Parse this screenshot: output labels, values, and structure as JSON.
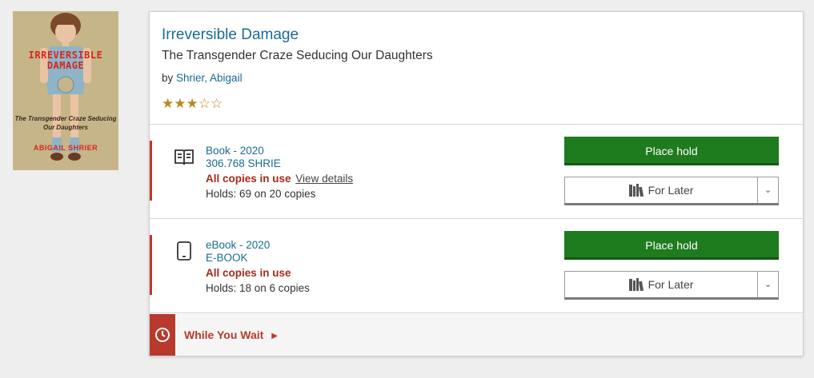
{
  "cover": {
    "title_line1": "IRREVERSIBLE",
    "title_line2": "DAMAGE",
    "subtitle_line1": "The Transgender Craze Seducing",
    "subtitle_line2": "Our Daughters",
    "author": "ABIGAIL SHRIER"
  },
  "record": {
    "title": "Irreversible Damage",
    "subtitle": "The Transgender Craze Seducing Our Daughters",
    "by_prefix": "by ",
    "author": "Shrier, Abigail",
    "rating": {
      "filled": 3,
      "total": 5,
      "filled_glyph": "★★★",
      "empty_glyph": "☆☆"
    }
  },
  "formats": [
    {
      "icon": "book-icon",
      "format_label": "Book - 2020",
      "call_number": "306.768 SHRIE",
      "availability": "All copies in use",
      "details_link": "View details",
      "holds": "Holds: 69 on 20 copies",
      "place_hold_label": "Place hold",
      "for_later_label": "For Later"
    },
    {
      "icon": "tablet-icon",
      "format_label": "eBook - 2020",
      "call_number": "E-BOOK",
      "availability": "All copies in use",
      "details_link": "",
      "holds": "Holds: 18 on 6 copies",
      "place_hold_label": "Place hold",
      "for_later_label": "For Later"
    }
  ],
  "while_you_wait": {
    "label": "While You Wait",
    "icon": "clock-icon"
  },
  "colors": {
    "link": "#1b6b93",
    "availability": "#a52a1c",
    "accent_red": "#b83a2c",
    "place_hold_green": "#1e7b1e",
    "star_gold": "#b88a1a"
  }
}
